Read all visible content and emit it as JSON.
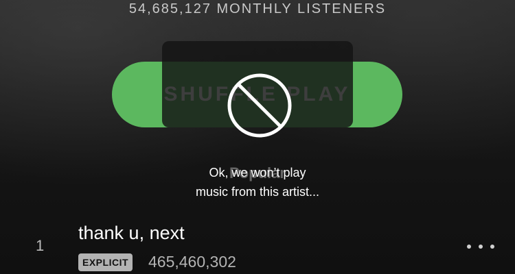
{
  "header": {
    "monthly_listeners": "54,685,127 MONTHLY LISTENERS"
  },
  "shuffle_button": {
    "label": "SHUFFLE PLAY",
    "color": "#5cb85f"
  },
  "section": {
    "title": "Popular"
  },
  "toast": {
    "icon": "prohibited-icon",
    "line1": "Ok, we won’t play",
    "line2": "music from this artist..."
  },
  "tracks": [
    {
      "number": "1",
      "title": "thank u, next",
      "badge": "EXPLICIT",
      "plays": "465,460,302"
    }
  ]
}
